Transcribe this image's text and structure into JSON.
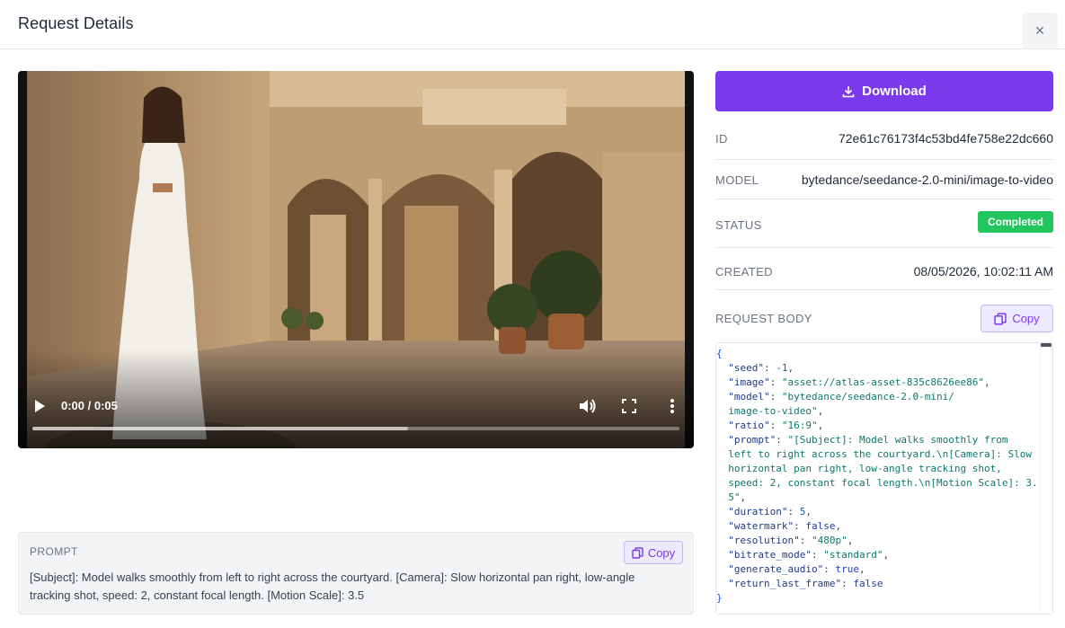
{
  "header": {
    "title": "Request Details",
    "close_label": "×"
  },
  "video": {
    "time": "0:00 / 0:05",
    "progress": 0.58
  },
  "prompt": {
    "label": "PROMPT",
    "copy_label": "Copy",
    "text": "[Subject]: Model walks smoothly from left to right across the courtyard. [Camera]: Slow horizontal pan right, low-angle tracking shot, speed: 2, constant focal length. [Motion Scale]: 3.5"
  },
  "download_label": "Download",
  "details": {
    "id_label": "ID",
    "id_value": "72e61c76173f4c53bd4fe758e22dc660",
    "model_label": "MODEL",
    "model_value": "bytedance/seedance-2.0-mini/image-to-video",
    "status_label": "STATUS",
    "status_value": "Completed",
    "created_label": "CREATED",
    "created_value": "08/05/2026, 10:02:11 AM"
  },
  "request_body": {
    "label": "REQUEST BODY",
    "copy_label": "Copy",
    "lines": [
      {
        "t": "brace",
        "s": "{"
      },
      {
        "t": "kv",
        "k": "\"seed\"",
        "sep": ": ",
        "v": "-1",
        "vt": "num",
        "e": ","
      },
      {
        "t": "kv",
        "k": "\"image\"",
        "sep": ": ",
        "v": "\"asset://atlas-asset-835c8626ee86\"",
        "vt": "str",
        "e": ","
      },
      {
        "t": "kv",
        "k": "\"model\"",
        "sep": ": ",
        "v": "\"bytedance/seedance-2.0-mini/",
        "vt": "str",
        "e": ""
      },
      {
        "t": "cont",
        "v": "image-to-video\"",
        "vt": "str",
        "e": ","
      },
      {
        "t": "kv",
        "k": "\"ratio\"",
        "sep": ": ",
        "v": "\"16:9\"",
        "vt": "str",
        "e": ","
      },
      {
        "t": "kv",
        "k": "\"prompt\"",
        "sep": ": ",
        "v": "\"[Subject]: Model walks smoothly from",
        "vt": "str",
        "e": ""
      },
      {
        "t": "cont",
        "v": "left to right across the courtyard.\\n[Camera]: Slow",
        "vt": "str",
        "e": ""
      },
      {
        "t": "cont",
        "v": "horizontal pan right, low-angle tracking shot,",
        "vt": "str",
        "e": ""
      },
      {
        "t": "cont",
        "v": "speed: 2, constant focal length.\\n[Motion Scale]: 3.",
        "vt": "str",
        "e": ""
      },
      {
        "t": "cont",
        "v": "5\"",
        "vt": "str",
        "e": ","
      },
      {
        "t": "kv",
        "k": "\"duration\"",
        "sep": ": ",
        "v": "5",
        "vt": "num",
        "e": ","
      },
      {
        "t": "kv",
        "k": "\"watermark\"",
        "sep": ": ",
        "v": "false",
        "vt": "bool",
        "e": ","
      },
      {
        "t": "kv",
        "k": "\"resolution\"",
        "sep": ": ",
        "v": "\"480p\"",
        "vt": "str",
        "e": ","
      },
      {
        "t": "kv",
        "k": "\"bitrate_mode\"",
        "sep": ": ",
        "v": "\"standard\"",
        "vt": "str",
        "e": ","
      },
      {
        "t": "kv",
        "k": "\"generate_audio\"",
        "sep": ": ",
        "v": "true",
        "vt": "bool",
        "e": ","
      },
      {
        "t": "kv",
        "k": "\"return_last_frame\"",
        "sep": ": ",
        "v": "false",
        "vt": "bool",
        "e": ""
      },
      {
        "t": "brace",
        "s": "}"
      }
    ]
  },
  "colors": {
    "accent": "#7c3aed",
    "status_green": "#22c55e"
  }
}
